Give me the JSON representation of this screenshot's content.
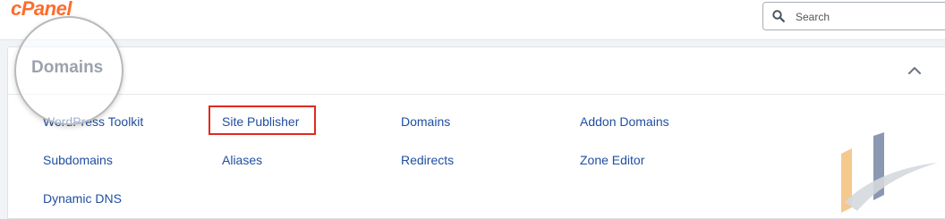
{
  "header": {
    "logo_text": "cPanel",
    "search": {
      "placeholder": "Search",
      "value": ""
    }
  },
  "section": {
    "title": "Domains",
    "collapse_icon": "chevron-up-icon",
    "links": [
      "WordPress Toolkit",
      "Site Publisher",
      "Domains",
      "Addon Domains",
      "Subdomains",
      "Aliases",
      "Redirects",
      "Zone Editor",
      "Dynamic DNS"
    ],
    "highlighted_link": "Site Publisher"
  },
  "colors": {
    "brand": "#ff6c2c",
    "link": "#1f4ea1",
    "highlight": "#e02a1e",
    "title": "#23304a"
  }
}
